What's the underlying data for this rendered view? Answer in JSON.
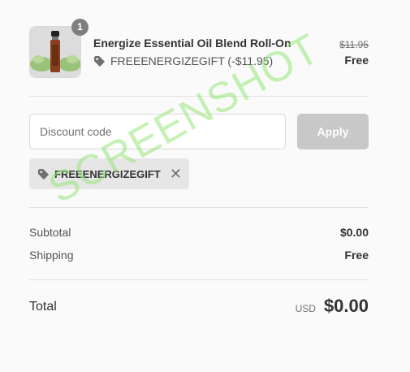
{
  "product": {
    "name": "Energize Essential Oil Blend Roll-On",
    "quantity": "1",
    "discount_line": "FREEENERGIZEGIFT (-$11.95)",
    "original_price": "$11.95",
    "final_price": "Free",
    "thumbnail_icon": "roll-on-bottle-icon"
  },
  "discount": {
    "placeholder": "Discount code",
    "apply_label": "Apply",
    "applied_code": "FREEENERGIZEGIFT",
    "remove_icon": "close-icon"
  },
  "summary": {
    "subtotal_label": "Subtotal",
    "subtotal_value": "$0.00",
    "shipping_label": "Shipping",
    "shipping_value": "Free",
    "total_label": "Total",
    "currency": "USD",
    "total_value": "$0.00"
  },
  "watermark": "SCREENSHOT"
}
